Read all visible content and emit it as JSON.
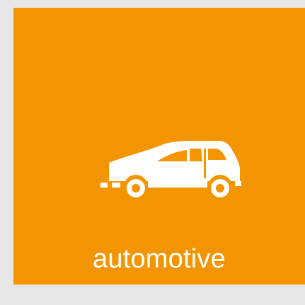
{
  "tile": {
    "label": "automotive",
    "icon": "car-icon",
    "background_color": "#f29500",
    "text_color": "#ffffff",
    "page_background": "#e6e6e6"
  }
}
